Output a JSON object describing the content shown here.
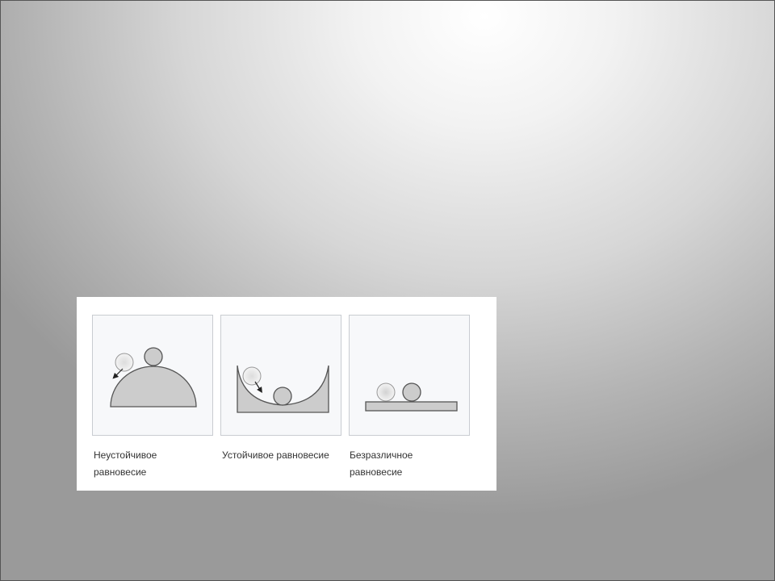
{
  "figure": {
    "diagrams": [
      {
        "caption_line1": "Неустойчивое",
        "caption_line2": "равновесие"
      },
      {
        "caption_line1": "Устойчивое равновесие",
        "caption_line2": ""
      },
      {
        "caption_line1": "Безразличное",
        "caption_line2": "равновесие"
      }
    ],
    "colors": {
      "surface_fill": "#cccccc",
      "outline": "#555555",
      "box_background": "#f7f8fa",
      "box_border": "#c9ccd1"
    }
  }
}
